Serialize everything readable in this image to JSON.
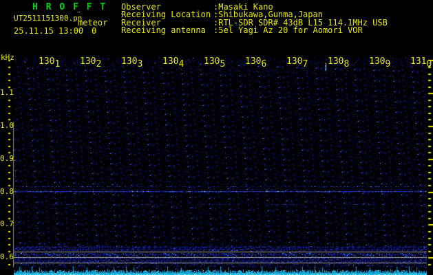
{
  "header": {
    "title": "H R O F F T",
    "filename": "UT2511151300.pn",
    "filename_artifact": "¨",
    "mode": "meteor",
    "datetime": "25.11.15 13:00",
    "echo_count": "0",
    "info": {
      "separator": ":",
      "rows": [
        {
          "label": "Observer",
          "value": "Masaki Kano"
        },
        {
          "label": "Receiving Location",
          "value": "Shibukawa,Gunma,Japan"
        },
        {
          "label": "Receiver",
          "value": "RTL-SDR SDR# 43dB L15 114.1MHz USB"
        },
        {
          "label": "Receiving antenna",
          "value": "5el Yagi Az 20 for Aomori VOR"
        }
      ]
    }
  },
  "chart_data": {
    "type": "heatmap",
    "description": "HROFFT radio-meteor observation spectrogram: 10-minute waterfall, time on top axis (UT hhmm), audio frequency in kHz on left axis, sparse blue noise field on black with carrier lines and a signal-level bar strip along the bottom",
    "x_axis": {
      "position": "top",
      "labels": [
        "1301",
        "1302",
        "1303",
        "1304",
        "1305",
        "1306",
        "1307",
        "1308",
        "1309",
        "1310"
      ],
      "trailing_mark": ".",
      "minutes_per_division": 1
    },
    "y_axis": {
      "unit_label": "kHz",
      "tick_labels": [
        "1.1",
        "1.0",
        "0.9",
        "0.8",
        "0.7",
        "0.6"
      ],
      "tick_values_khz": [
        1.1,
        1.0,
        0.9,
        0.8,
        0.7,
        0.6
      ],
      "minor_tick_step_khz": 0.02,
      "visible_range_khz": [
        0.56,
        1.2
      ]
    },
    "signal_lines": [
      {
        "khz": 0.815,
        "style": "faint-speckle",
        "note": "thin speckled line with occasional cyan dots"
      },
      {
        "khz": 0.802,
        "style": "strong",
        "note": "continuous blue carrier line with bright cyan/white specks"
      },
      {
        "khz": 0.762,
        "style": "intermittent",
        "note": "patchy dashed dark-blue line"
      }
    ],
    "noise_bands": [
      {
        "khz_range": [
          0.622,
          0.633
        ],
        "density": 0.38,
        "bright": false
      },
      {
        "khz_range": [
          0.604,
          0.614
        ],
        "density": 0.46,
        "bright": true
      },
      {
        "khz_range": [
          0.585,
          0.598
        ],
        "density": 0.38,
        "bright": false
      },
      {
        "khz_range": [
          0.566,
          0.582
        ],
        "density": 0.2,
        "bright": false
      }
    ],
    "reference_lines_khz": [
      0.617,
      0.6,
      0.583
    ],
    "meteor_echoes": [
      {
        "near_time_label": "1308",
        "minutes_offset": 7.55,
        "khz_range": [
          1.17,
          1.19
        ],
        "note": "short bright cyan vertical streak at top of band"
      }
    ],
    "bottom_strip": {
      "kind": "signal-level-bars",
      "color": "#18b8e0",
      "note": "cyan comb of varying-height bars along bottom edge"
    },
    "colors": {
      "background": "#000000",
      "axis_text": "#e9e900",
      "title_text": "#00d414",
      "reference_line": "#a8a8a8",
      "left_border_line": "#8f8f8f",
      "carrier_blue": "#2433c8",
      "noise_blue": "#161d8c",
      "bright_cyan": "#70e8ff"
    }
  }
}
